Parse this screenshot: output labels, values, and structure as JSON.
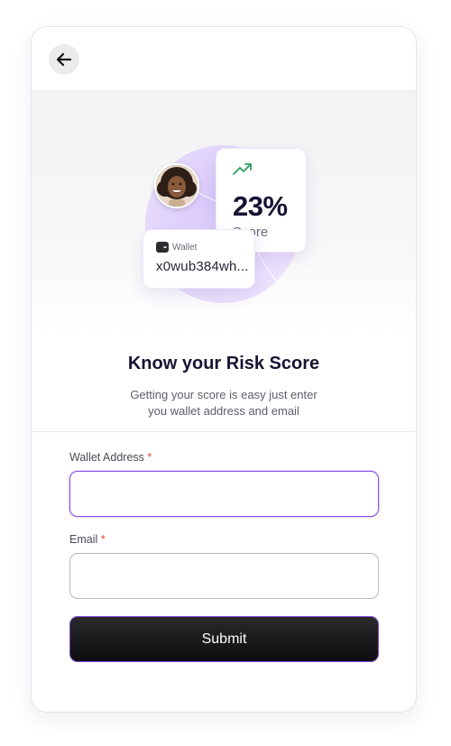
{
  "header": {
    "back_icon": "arrow-left-icon"
  },
  "hero": {
    "score": {
      "value": "23%",
      "label": "Score",
      "icon": "trending-up-icon",
      "icon_color": "#2f9e5b"
    },
    "wallet": {
      "title": "Wallet",
      "address": "x0wub384wh...",
      "icon": "wallet-icon"
    },
    "avatar": "user-avatar",
    "blob_color": "#d9c9fb"
  },
  "intro": {
    "title": "Know your Risk Score",
    "subtitle": "Getting your score is easy just enter you wallet address and email"
  },
  "form": {
    "wallet_label": "Wallet Address",
    "wallet_value": "",
    "wallet_placeholder": "",
    "email_label": "Email",
    "email_value": "",
    "email_placeholder": "",
    "required_mark": "*",
    "submit_label": "Submit"
  },
  "colors": {
    "accent": "#8a52e8",
    "required": "#e0453a",
    "title": "#1a1233"
  }
}
